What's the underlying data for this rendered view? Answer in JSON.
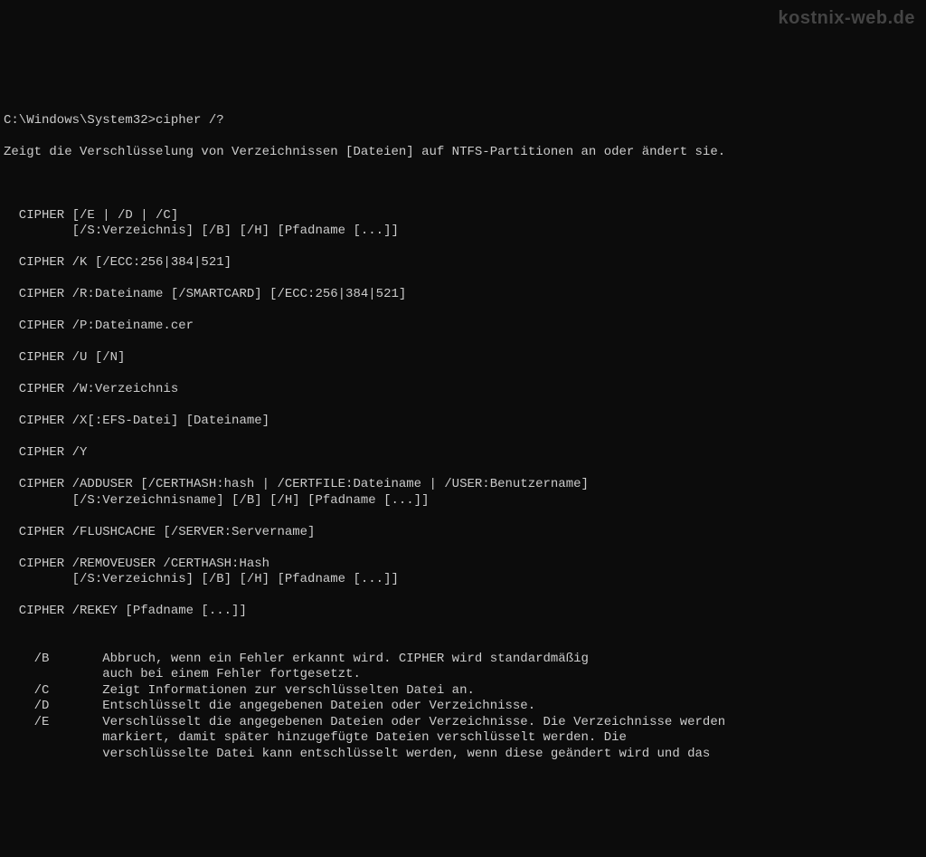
{
  "watermark": "kostnix-web.de",
  "prompt": "C:\\Windows\\System32>",
  "command": "cipher /?",
  "description": "Zeigt die Verschlüsselung von Verzeichnissen [Dateien] auf NTFS-Partitionen an oder ändert sie.",
  "usage": [
    "  CIPHER [/E | /D | /C]",
    "         [/S:Verzeichnis] [/B] [/H] [Pfadname [...]]",
    "",
    "  CIPHER /K [/ECC:256|384|521]",
    "",
    "  CIPHER /R:Dateiname [/SMARTCARD] [/ECC:256|384|521]",
    "",
    "  CIPHER /P:Dateiname.cer",
    "",
    "  CIPHER /U [/N]",
    "",
    "  CIPHER /W:Verzeichnis",
    "",
    "  CIPHER /X[:EFS-Datei] [Dateiname]",
    "",
    "  CIPHER /Y",
    "",
    "  CIPHER /ADDUSER [/CERTHASH:hash | /CERTFILE:Dateiname | /USER:Benutzername]",
    "         [/S:Verzeichnisname] [/B] [/H] [Pfadname [...]]",
    "",
    "  CIPHER /FLUSHCACHE [/SERVER:Servername]",
    "",
    "  CIPHER /REMOVEUSER /CERTHASH:Hash",
    "         [/S:Verzeichnis] [/B] [/H] [Pfadname [...]]",
    "",
    "  CIPHER /REKEY [Pfadname [...]]",
    ""
  ],
  "options": [
    {
      "flag": "/B",
      "desc1": "Abbruch, wenn ein Fehler erkannt wird. CIPHER wird standardmäßig",
      "desc2": "auch bei einem Fehler fortgesetzt."
    },
    {
      "flag": "/C",
      "desc1": "Zeigt Informationen zur verschlüsselten Datei an."
    },
    {
      "flag": "/D",
      "desc1": "Entschlüsselt die angegebenen Dateien oder Verzeichnisse."
    },
    {
      "flag": "/E",
      "desc1": "Verschlüsselt die angegebenen Dateien oder Verzeichnisse. Die Verzeichnisse werden",
      "desc2": "markiert, damit später hinzugefügte Dateien verschlüsselt werden. Die",
      "desc3": "verschlüsselte Datei kann entschlüsselt werden, wenn diese geändert wird und das"
    }
  ]
}
